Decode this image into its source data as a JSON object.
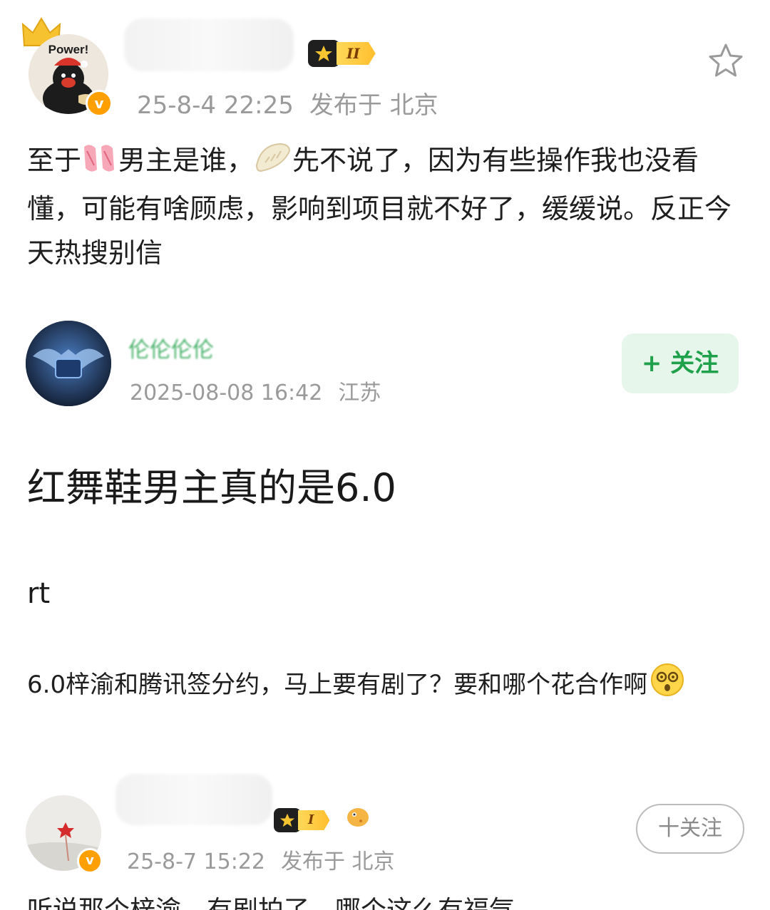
{
  "post1": {
    "avatar_caption": "Power!",
    "verified_mark": "v",
    "rank_level": "II",
    "date": "25-8-4 22:25",
    "location": "发布于 北京",
    "content_part1": "至于",
    "content_part2": "男主是谁，",
    "content_part3": "先不说了，因为有些操作我也没看懂，可能有啥顾虑，影响到项目就不好了，缓缓说。反正今天热搜别信"
  },
  "post2": {
    "username_partial": "伦伦伦伦",
    "date": "2025-08-08 16:42",
    "location": "江苏",
    "follow_label": "+ 关注",
    "title": "红舞鞋男主真的是6.0",
    "subtitle": "rt",
    "description": "6.0梓渝和腾讯签分约，马上要有剧了？要和哪个花合作啊"
  },
  "post3": {
    "verified_mark": "v",
    "rank_level": "I",
    "date": "25-8-7 15:22",
    "location": "发布于 北京",
    "follow_label": "十关注",
    "content_partial": "听说那个梓渝，有剧拍了，哪个这么有福气"
  },
  "colors": {
    "accent_green": "#1fa04a",
    "follow_green_bg": "#e7f6ea",
    "verified_orange": "#ff9f00",
    "meta_gray": "#9a9a9a"
  }
}
